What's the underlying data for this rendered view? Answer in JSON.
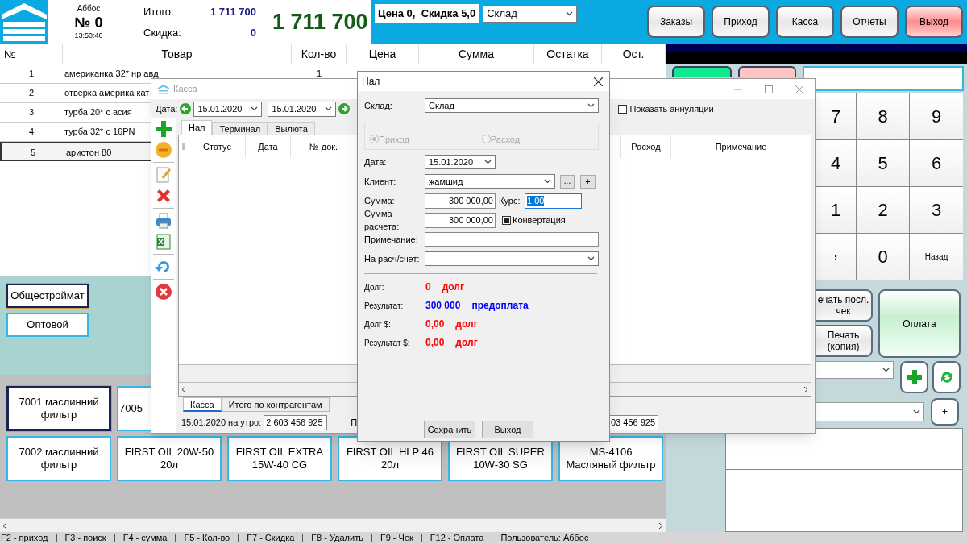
{
  "header": {
    "cashier": "Аббос",
    "order_no": "№ 0",
    "time": "13:50:46",
    "total_label": "Итого:",
    "total": "1 711 700",
    "discount_label": "Скидка:",
    "discount": "0",
    "grand_total": "1 711 700",
    "price_info": "Цена 0,  Скидка 5,0",
    "warehouse": "Склад"
  },
  "nav_buttons": [
    {
      "label": "Заказы",
      "kind": "normal"
    },
    {
      "label": "Приход",
      "kind": "normal"
    },
    {
      "label": "Касса",
      "kind": "normal"
    },
    {
      "label": "Отчеты",
      "kind": "normal"
    },
    {
      "label": "Выход",
      "kind": "danger"
    }
  ],
  "cart": {
    "columns": [
      "№",
      "Товар",
      "Кол-во",
      "Цена",
      "Сумма",
      "Остатка",
      "Ост."
    ],
    "rows": [
      {
        "cells": [
          "1",
          "американка 32* нр авд",
          "1"
        ],
        "selected": false
      },
      {
        "cells": [
          "2",
          "отверка америка кат"
        ],
        "selected": false
      },
      {
        "cells": [
          "3",
          "турба 20* с асия"
        ],
        "selected": false
      },
      {
        "cells": [
          "4",
          "турба 32* с 16PN"
        ],
        "selected": false
      },
      {
        "cells": [
          "5",
          "аристон 80"
        ],
        "selected": true
      }
    ]
  },
  "price_groups": [
    {
      "label": "Общестроймат",
      "selected": true
    },
    {
      "label": "Оптовой",
      "selected": false
    }
  ],
  "product_rows": [
    [
      {
        "label": "7001 маслинний фильтр",
        "selected": true
      },
      {
        "label": "7005",
        "selected": false
      }
    ],
    [
      {
        "label": "7002 маслинний фильтр",
        "selected": false
      },
      {
        "label": "FIRST OIL 20W-50 20л",
        "selected": false
      },
      {
        "label": "FIRST OIL EXTRA 15W-40 CG",
        "selected": false
      },
      {
        "label": "FIRST OIL HLP 46 20л",
        "selected": false
      },
      {
        "label": "FIRST OIL SUPER 10W-30 SG",
        "selected": false
      },
      {
        "label": "MS-4106 Масляный фильтр",
        "selected": false
      }
    ]
  ],
  "status_bar": [
    "F2 - приход",
    "F3 - поиск",
    "F4 - сумма",
    "F5 - Кол-во",
    "F7 - Скидка",
    "F8 - Удалить",
    "F9 - Чек",
    "F12 - Оплата",
    "Пользователь: Аббос"
  ],
  "keypad": [
    "7",
    "8",
    "9",
    "4",
    "5",
    "6",
    "1",
    "2",
    "3",
    ",",
    "0",
    "Назад"
  ],
  "side_buttons": {
    "print_last": "ечать посл. чек",
    "print_copy": "Печать (копия)",
    "pay": "Оплата",
    "add_symbol": "+"
  },
  "kassa_window": {
    "title": "Касса",
    "date_label": "Дата:",
    "date_from": "15.01.2020",
    "date_to": "15.01.2020",
    "show_cancelled": {
      "label": "Показать аннуляции",
      "checked": false
    },
    "tabs": [
      {
        "label": "Нал",
        "selected": true
      },
      {
        "label": "Терминал",
        "selected": false
      },
      {
        "label": "Вылюта",
        "selected": false
      }
    ],
    "columns": [
      "Статус",
      "Дата",
      "№ док.",
      "Расход",
      "Примечание"
    ],
    "bottom_tabs": [
      {
        "label": "Касса",
        "selected": true
      },
      {
        "label": "Итого по контрагентам",
        "selected": false
      }
    ],
    "morning_label": "15.01.2020 на утро:",
    "morning_value": "2 603 456 925",
    "partial_label": "П",
    "partial_value": "03 456 925"
  },
  "nal_dialog": {
    "title": "Нал",
    "warehouse_label": "Склад:",
    "warehouse": "Склад",
    "radios": [
      {
        "label": "Приход",
        "selected": true
      },
      {
        "label": "Расход",
        "selected": false
      }
    ],
    "radios_disabled": true,
    "date_label": "Дата:",
    "date": "15.01.2020",
    "client_label": "Клиент:",
    "client": "жамшид",
    "more_button": "...",
    "add_button": "+",
    "sum_label": "Сумма:",
    "sum": "300 000,00",
    "rate_label": "Курс:",
    "rate": "1,00",
    "calc_sum_label": "Сумма расчета:",
    "calc_sum": "300 000,00",
    "conversion": {
      "label": "Конвертация",
      "checked": true
    },
    "note_label": "Примечание:",
    "account_label": "На расч/счет:",
    "summary": [
      {
        "label": "Долг:",
        "value": "0",
        "word": "долг",
        "color": "#ff0000"
      },
      {
        "label": "Результат:",
        "value": "300 000",
        "word": "предоплата",
        "color": "#0000ff"
      },
      {
        "label": "Долг $:",
        "value": "0,00",
        "word": "долг",
        "color": "#ff0000"
      },
      {
        "label": "Результат $:",
        "value": "0,00",
        "word": "долг",
        "color": "#ff0000"
      }
    ],
    "save_button": "Сохранить",
    "exit_button": "Выход"
  }
}
